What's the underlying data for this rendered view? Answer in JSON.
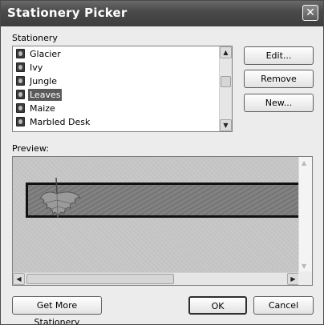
{
  "window": {
    "title": "Stationery Picker",
    "close_glyph": "✕"
  },
  "stationery": {
    "label": "Stationery",
    "items": [
      {
        "label": "Glacier",
        "selected": false
      },
      {
        "label": "Ivy",
        "selected": false
      },
      {
        "label": "Jungle",
        "selected": false
      },
      {
        "label": "Leaves",
        "selected": true
      },
      {
        "label": "Maize",
        "selected": false
      },
      {
        "label": "Marbled Desk",
        "selected": false
      }
    ]
  },
  "buttons": {
    "edit": "Edit...",
    "remove": "Remove",
    "new": "New...",
    "get_more": "Get More Stationery",
    "ok": "OK",
    "cancel": "Cancel"
  },
  "preview": {
    "label": "Preview:"
  },
  "icons": {
    "scroll_up": "▲",
    "scroll_down": "▼",
    "scroll_left": "◀",
    "scroll_right": "▶",
    "item_icon": "stationery-icon",
    "leaf": "leaf-icon"
  },
  "colors": {
    "title_bar": "#4a4a4a",
    "selection": "#5a5a5a"
  }
}
